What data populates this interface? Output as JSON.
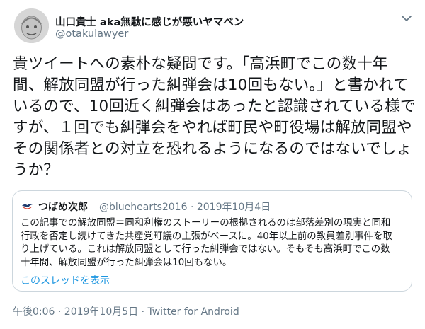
{
  "author": {
    "display_name": "山口貴士 aka無駄に感じが悪いヤマベン",
    "handle": "@otakulawyer"
  },
  "tweet": {
    "lines": [
      "貴ツイートへの素朴な疑問です。「高浜町でこの数十年",
      "間、解放同盟が行った糾弾会は10回もない。」と書かれて",
      "いるので、10回近く糾弾会はあったと認識されている様で",
      "すが、１回でも糾弾会をやれば町民や町役場は解放同盟や",
      "その関係者との対立を恐れるようになるのではないでしょ",
      "うか？"
    ]
  },
  "quoted": {
    "display_name": "つばめ次郎",
    "meta": "@bluehearts2016 · 2019年10月4日",
    "lines": [
      "この記事での解放同盟＝同和利権のストーリーの根拠されるのは部落差別の現実と同和",
      "行政を否定し続けてきた共産党町議の主張がベースに。40年以上前の教員差別事件を取",
      "り上げている。これは解放同盟として行った糾弾会ではない。そもそも高浜町でこの数",
      "十年間、解放同盟が行った糾弾会は10回もない。"
    ],
    "thread_link": "このスレッドを表示"
  },
  "footer": {
    "timestamp": "午後0:06 · 2019年10月5日",
    "separator": " · ",
    "source": "Twitter for Android"
  },
  "colors": {
    "text": "#14171a",
    "secondary": "#657786",
    "link": "#1b95e0",
    "border": "#ccd6dd"
  },
  "icons": {
    "caret": "chevron-down-icon",
    "avatar": "user-avatar",
    "quoted_avatar": "swallow-avatar"
  }
}
